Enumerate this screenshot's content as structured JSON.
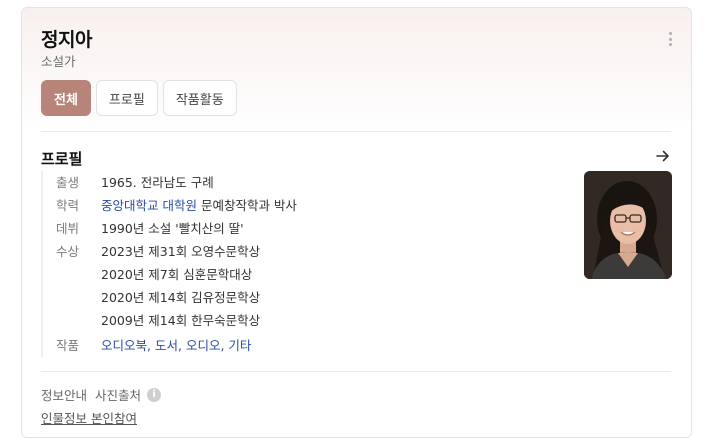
{
  "header": {
    "name": "정지아",
    "occupation": "소설가"
  },
  "tabs": [
    {
      "label": "전체",
      "active": true
    },
    {
      "label": "프로필",
      "active": false
    },
    {
      "label": "작품활동",
      "active": false
    }
  ],
  "profile": {
    "section_title": "프로필",
    "birth": {
      "label": "출생",
      "value": "1965. 전라남도 구례"
    },
    "education": {
      "label": "학력",
      "link": "중앙대학교 대학원",
      "rest": " 문예창작학과 박사"
    },
    "debut": {
      "label": "데뷔",
      "value": "1990년 소설 '빨치산의 딸'"
    },
    "awards": {
      "label": "수상",
      "items": [
        "2023년 제31회 오영수문학상",
        "2020년 제7회 심훈문학대상",
        "2020년 제14회 김유정문학상",
        "2009년 제14회 한무숙문학상"
      ]
    },
    "works": {
      "label": "작품",
      "links": [
        "오디오북",
        "도서",
        "오디오",
        "기타"
      ],
      "separator": ", "
    }
  },
  "footer": {
    "info_label": "정보안내",
    "photo_source": "사진출처",
    "participate": "인물정보 본인참여"
  },
  "icons": {
    "more": "more-vertical-icon",
    "arrow": "arrow-right-icon",
    "info": "info-icon"
  },
  "colors": {
    "accent": "#b88479",
    "link": "#2a4ba8"
  }
}
